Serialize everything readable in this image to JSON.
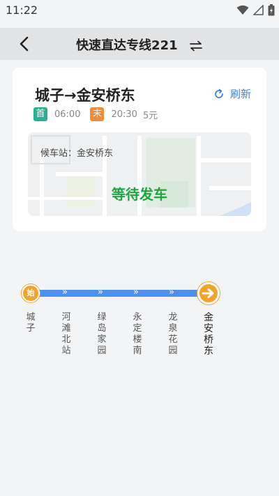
{
  "status_bar": {
    "time": "11:22"
  },
  "header": {
    "title": "快速直达专线221"
  },
  "route": {
    "name": "城子→金安桥东",
    "refresh_label": "刷新",
    "first_tag": "首",
    "first_time": "06:00",
    "last_tag": "末",
    "last_time": "20:30",
    "price": "5元",
    "waiting_station": "候车站：金安桥东",
    "bus_status": "等待发车"
  },
  "line": {
    "start_marker": "始",
    "stops": [
      {
        "name": "城子"
      },
      {
        "name": "河滩北站"
      },
      {
        "name": "绿岛家园"
      },
      {
        "name": "永定楼南"
      },
      {
        "name": "龙泉花园"
      },
      {
        "name": "金安桥东"
      }
    ]
  },
  "colors": {
    "accent": "#3a82f0",
    "status_green": "#18a83e",
    "first_tag": "#27b292",
    "last_tag": "#f08a3c",
    "line": "#4c8ff2",
    "marker": "#f4a32a"
  }
}
